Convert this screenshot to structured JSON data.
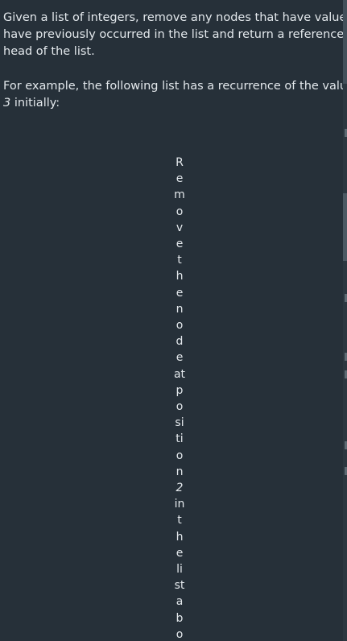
{
  "intro": {
    "lines": [
      "Given a list of integers, remove any nodes that have values that",
      "have previously occurred in the list and return a reference to the",
      "head of the list."
    ]
  },
  "example": {
    "line1": "For example, the following list has a recurrence of the value",
    "value": "3",
    "line2_rest": " initially:"
  },
  "image_alt": {
    "chunks": [
      "R",
      "e",
      "m",
      "o",
      "v",
      "e",
      "t",
      "h",
      "e",
      "n",
      "o",
      "d",
      "e",
      "at",
      "p",
      "o",
      "si",
      "ti",
      "o",
      "n",
      "2",
      "in",
      "t",
      "h",
      "e",
      "li",
      "st",
      "a",
      "b",
      "o"
    ]
  }
}
